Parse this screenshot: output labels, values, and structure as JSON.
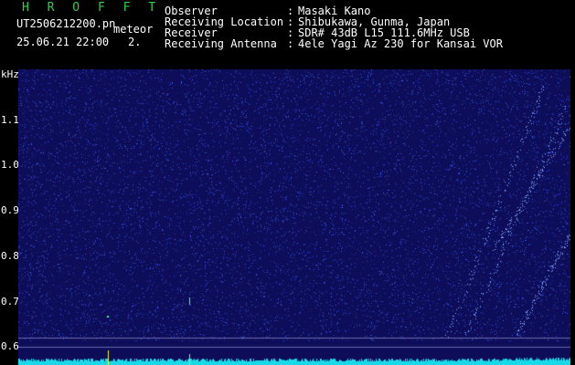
{
  "header": {
    "app_name": "H R O F F T",
    "filename": "UT2506212200.pn",
    "tag": "meteor",
    "datetime": "25.06.21 22:00",
    "count": "2.",
    "fields": [
      {
        "label": "Observer",
        "value": "Masaki Kano"
      },
      {
        "label": "Receiving Location",
        "value": "Shibukawa, Gunma, Japan"
      },
      {
        "label": "Receiver",
        "value": "SDR# 43dB L15 111.6MHz USB"
      },
      {
        "label": "Receiving Antenna",
        "value": "4ele Yagi Az 230 for Kansai VOR"
      }
    ]
  },
  "time_axis": {
    "labels": [
      "220",
      "220",
      "220",
      "220",
      "220",
      "220",
      "220",
      "220",
      "220",
      "2210"
    ]
  },
  "freq_axis": {
    "unit": "kHz",
    "labels": [
      "1.1",
      "1.0",
      "0.9",
      "0.8",
      "0.7",
      "0.6"
    ]
  },
  "colors": {
    "background": "#000000",
    "spectrogram_base": "#0d0d5a",
    "noise_dot": "#3a5cff",
    "header_text": "#ffffff",
    "app_name": "#2fd04a",
    "tick_text": "#ffff00",
    "noise_floor_trace": "#19d8e8"
  }
}
